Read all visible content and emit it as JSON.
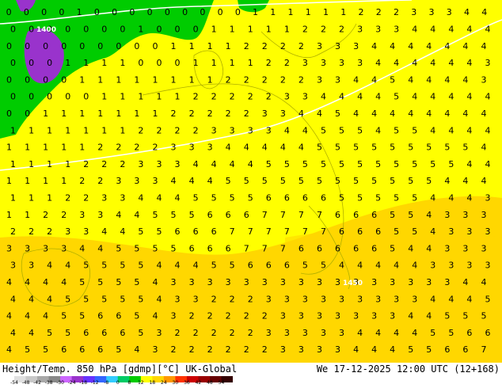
{
  "header": {
    "title": "Height/Temp. 850 hPa [gdmp][°C] UK-Global",
    "valid_time": "We 17-12-2025 12:00 UTC (12+168)"
  },
  "map": {
    "region": "Europe / North Atlantic",
    "variable": "Temperature at 850 hPa (°C) with geopotential height contours",
    "colors": {
      "background_warm": "#ffff00",
      "mild_band": "#ffd700",
      "land_ocean_edge": "#ffe000",
      "cold_band": "#00cc00",
      "very_cold_band": "#9933cc",
      "label_text": "#000000",
      "contour": "#ffffff"
    },
    "contour_labels": [
      "1400",
      "1450"
    ]
  },
  "colorbar": {
    "tick_labels": [
      "-54",
      "-48",
      "-42",
      "-38",
      "-30",
      "-24",
      "-18",
      "-12",
      "-8",
      "0",
      "8",
      "12",
      "18",
      "24",
      "30",
      "36",
      "42",
      "48",
      "54"
    ],
    "colors": [
      "#e0e0e0",
      "#c8c8c8",
      "#a8a8a8",
      "#888888",
      "#cc66ff",
      "#9933cc",
      "#6633ff",
      "#3366ff",
      "#33ccff",
      "#00cc66",
      "#00cc00",
      "#ffff00",
      "#ffd700",
      "#ff9900",
      "#ff3300",
      "#cc0000",
      "#990000",
      "#660000",
      "#330000"
    ]
  },
  "grid_labels": [
    "0 0 0 0 1 0 0 0 0 0 0 0 0 0 1 1 1 1 1 1 2 2 2 3 3 3 4 4",
    "0 0 0 0 0 0 0 1 0 0 0 1 1 1 1 1 2 2 2 3 3 3 4 4 4 4 4",
    "0 0 0 0 0 0 0 0 0 1 1 1 1 2 2 2 2 3 3 3 4 4 4 4 4 4 4",
    "0 0 0 1 1 1 1 0 0 0 1 1 1 1 2 2 3 3 3 3 4 4 4 4 4 4 3",
    "0 0 0 0 1 1 1 1 1 1 1 1 2 2 2 2 2 3 3 4 4 5 4 4 4 4 3",
    "0 0 0 0 0 1 1 1 1 1 2 2 2 2 2 3 3 4 4 4 4 5 4 4 4 4 4",
    "0 0 1 1 1 1 1 1 1 2 2 2 2 2 3 3 4 4 5 4 4 4 4 4 4 4 4",
    "1 1 1 1 1 1 1 2 2 2 2 3 3 3 3 4 4 5 5 5 4 5 5 4 4 4 4",
    "1 1 1 1 1 2 2 2 2 3 3 3 4 4 4 4 4 5 5 5 5 5 5 5 5 5 4",
    "1 1 1 1 2 2 2 3 3 3 4 4 4 4 5 5 5 5 5 5 5 5 5 5 5 4 4",
    "1 1 1 1 2 2 3 3 3 4 4 4 5 5 5 5 5 5 5 5 5 5 5 5 4 4 4",
    "1 1 1 2 2 3 3 4 4 4 5 5 5 5 6 6 6 6 5 5 5 5 5 4 4 4 3",
    "1 1 2 2 3 3 4 4 5 5 5 6 6 6 7 7 7 7 6 6 6 5 5 4 3 3 3",
    "2 2 2 3 3 4 4 5 5 6 6 6 7 7 7 7 7 7 6 6 6 5 5 4 3 3 3",
    "3 3 3 3 4 4 5 5 5 5 6 6 6 7 7 7 6 6 6 6 6 5 4 4 3 3 3",
    "3 3 4 4 5 5 5 5 4 4 4 5 5 6 6 6 5 5 4 4 4 4 4 3 3 3 3",
    "4 4 4 4 5 5 5 5 4 3 3 3 3 3 3 3 3 3 3 3 3 3 3 3 3 4 4",
    "4 4 4 5 5 5 5 5 4 3 3 2 2 2 3 3 3 3 3 3 3 3 3 4 4 4 5",
    "4 4 4 5 5 6 6 5 4 3 2 2 2 2 2 3 3 3 3 3 3 3 4 4 5 5 5",
    "4 4 5 5 6 6 6 5 3 2 2 2 2 2 3 3 3 3 3 4 4 4 4 5 5 6 6",
    "4 5 5 6 6 6 5 4 3 2 2 2 2 2 2 3 3 3 3 4 4 4 5 5 6 6 7"
  ]
}
